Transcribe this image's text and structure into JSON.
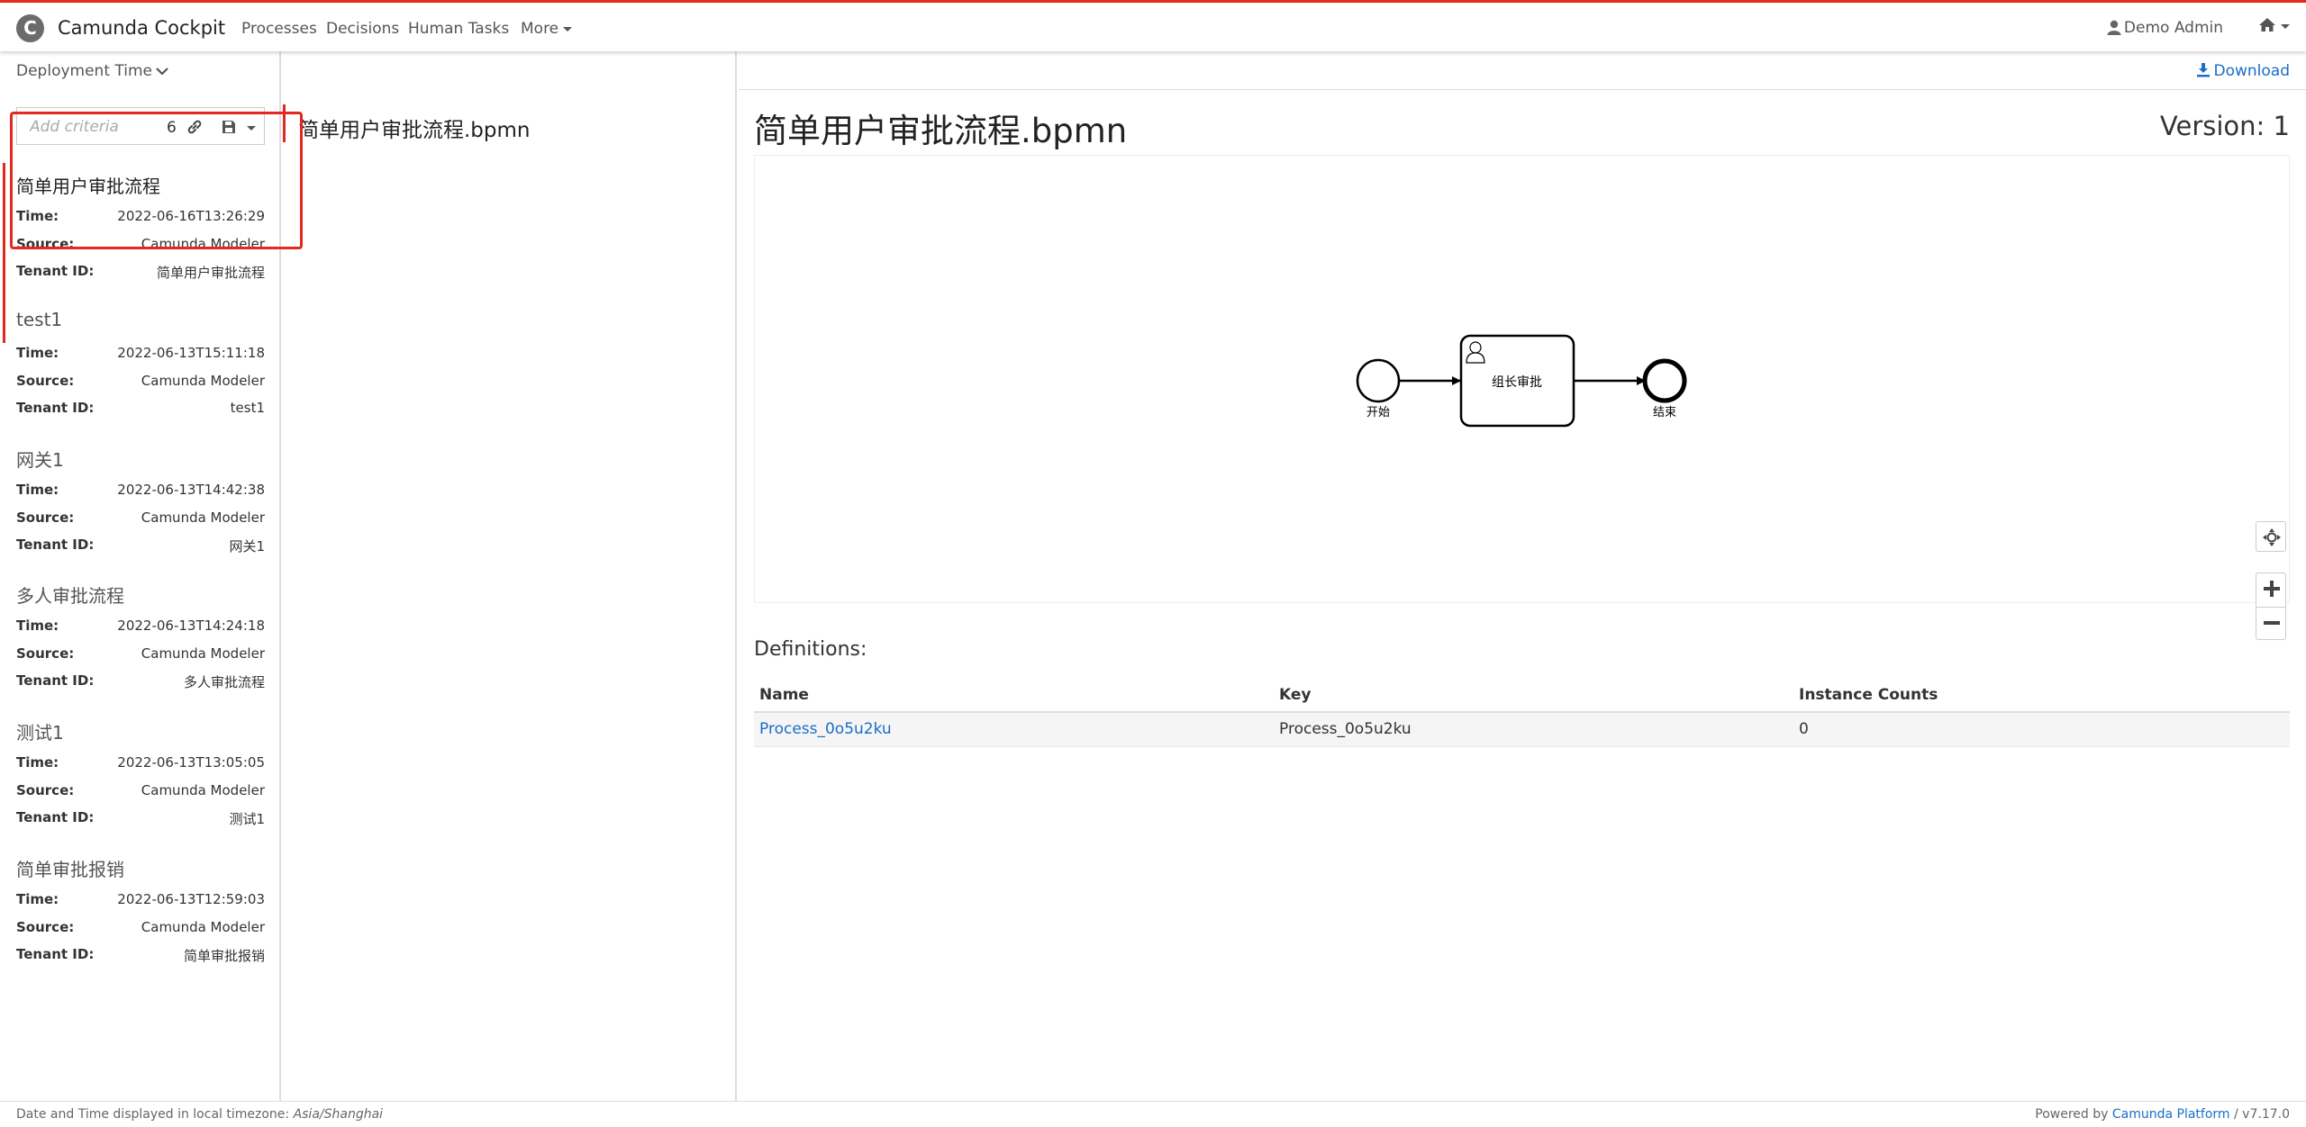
{
  "header": {
    "logo_letter": "C",
    "brand": "Camunda Cockpit",
    "nav": {
      "processes": "Processes",
      "decisions": "Decisions",
      "human_tasks": "Human Tasks",
      "more": "More"
    },
    "user": "Demo Admin",
    "accent_color": "#e3281f"
  },
  "sidebar": {
    "sort_label": "Deployment Time",
    "search": {
      "placeholder": "Add criteria",
      "count": "6"
    },
    "labels": {
      "time": "Time:",
      "source": "Source:",
      "tenant": "Tenant ID:"
    },
    "deployments": [
      {
        "name": "简单用户审批流程",
        "time": "2022-06-16T13:26:29",
        "source": "Camunda Modeler",
        "tenant": "简单用户审批流程"
      },
      {
        "name": "test1",
        "time": "2022-06-13T15:11:18",
        "source": "Camunda Modeler",
        "tenant": "test1"
      },
      {
        "name": "网关1",
        "time": "2022-06-13T14:42:38",
        "source": "Camunda Modeler",
        "tenant": "网关1"
      },
      {
        "name": "多人审批流程",
        "time": "2022-06-13T14:24:18",
        "source": "Camunda Modeler",
        "tenant": "多人审批流程"
      },
      {
        "name": "测试1",
        "time": "2022-06-13T13:05:05",
        "source": "Camunda Modeler",
        "tenant": "测试1"
      },
      {
        "name": "简单审批报销",
        "time": "2022-06-13T12:59:03",
        "source": "Camunda Modeler",
        "tenant": "简单审批报销"
      }
    ]
  },
  "resources": {
    "items": [
      "简单用户审批流程.bpmn"
    ]
  },
  "detail": {
    "download": "Download",
    "title": "简单用户审批流程.bpmn",
    "version": "Version: 1",
    "diagram": {
      "start_label": "开始",
      "task_label": "组长审批",
      "end_label": "结束"
    },
    "definitions_title": "Definitions:",
    "table": {
      "headers": [
        "Name",
        "Key",
        "Instance Counts"
      ],
      "rows": [
        [
          "Process_0o5u2ku",
          "Process_0o5u2ku",
          "0"
        ]
      ]
    }
  },
  "footer": {
    "timezone_prefix": "Date and Time displayed in local timezone: ",
    "timezone": "Asia/Shanghai",
    "powered_prefix": "Powered by ",
    "platform": "Camunda Platform",
    "version": " / v7.17.0"
  }
}
